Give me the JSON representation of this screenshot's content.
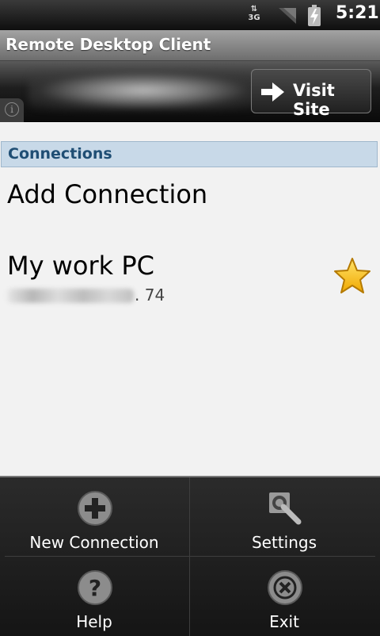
{
  "status_bar": {
    "network": "3G",
    "time": "5:21",
    "icons": [
      "data-arrows-icon",
      "signal-icon",
      "battery-charging-icon"
    ]
  },
  "app": {
    "title": "Remote Desktop Client"
  },
  "banner": {
    "visit_label": "Visit Site",
    "icons": [
      "info-icon",
      "arrow-right-icon"
    ]
  },
  "connections": {
    "header": "Connections",
    "add_label": "Add Connection",
    "items": [
      {
        "name": "My work PC",
        "address_suffix": ". 74",
        "favorite": true
      }
    ]
  },
  "menu": {
    "items": [
      {
        "label": "New Connection",
        "icon": "plus-circle-icon"
      },
      {
        "label": "Settings",
        "icon": "wrench-icon"
      },
      {
        "label": "Help",
        "icon": "question-icon"
      },
      {
        "label": "Exit",
        "icon": "close-circle-icon"
      }
    ]
  },
  "colors": {
    "section_header_bg": "#c8d9e8",
    "section_header_text": "#1f4e74",
    "content_bg": "#f2f2f2",
    "star": "#f7c21b"
  }
}
